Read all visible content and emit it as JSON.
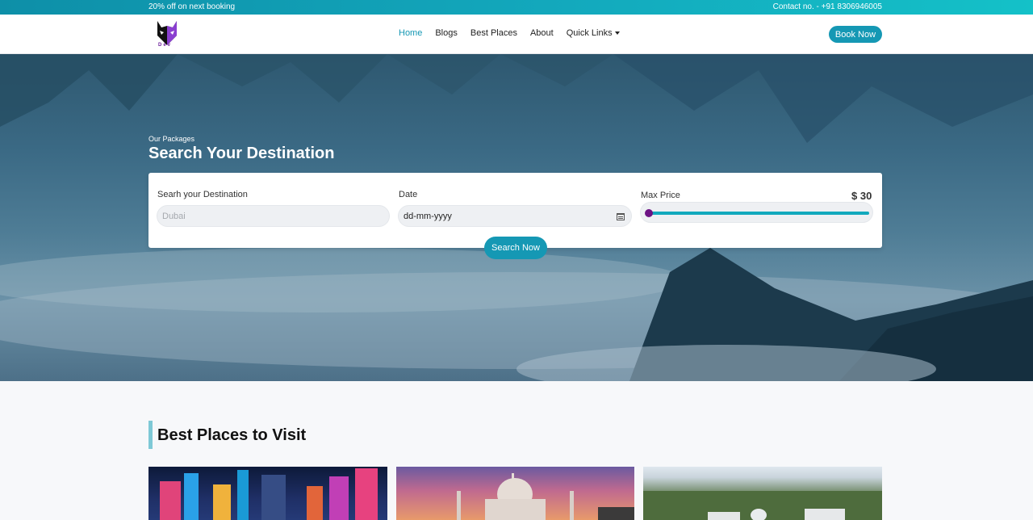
{
  "topbar": {
    "promo": "20% off on next booking",
    "contact": "Contact no. - +91 8306946005"
  },
  "navbar": {
    "logo_text": "Dev",
    "links": [
      "Home",
      "Blogs",
      "Best Places",
      "About"
    ],
    "quick_links": "Quick Links",
    "book_now": "Book Now"
  },
  "hero": {
    "subtitle": "Our Packages",
    "title": "Search Your Destination",
    "destination_label": "Searh your Destination",
    "destination_placeholder": "Dubai",
    "date_label": "Date",
    "date_placeholder": "dd-mm-yyyy",
    "price_label": "Max Price",
    "price_value": "$ 30",
    "price_fraction": 0.0,
    "search_button": "Search Now"
  },
  "best_places": {
    "title": "Best Places to Visit"
  },
  "colors": {
    "accent": "#1598b4",
    "slider_thumb": "#6d1384"
  }
}
